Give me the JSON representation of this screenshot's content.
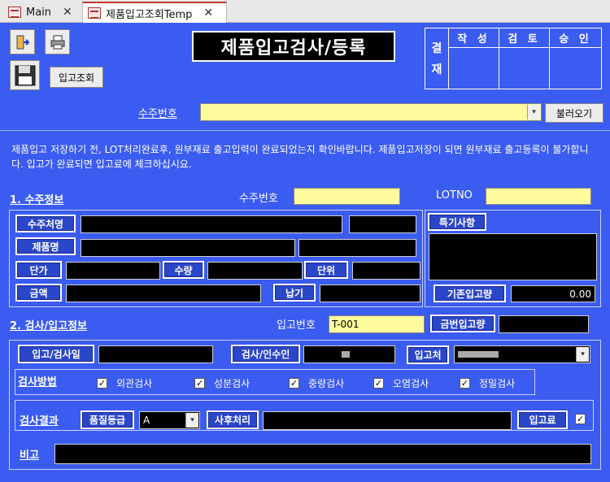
{
  "tabs": [
    {
      "label": "Main",
      "close": "✕"
    },
    {
      "label": "제품입고조회Temp",
      "close": "✕"
    }
  ],
  "toolbar": {
    "exit_icon": "exit-door-icon",
    "print_icon": "printer-icon",
    "save_icon": "floppy-disk-icon",
    "receipt_lookup_label": "입고조회"
  },
  "title": "제품입고검사/등록",
  "approval": {
    "label_top": "결",
    "label_bottom": "재",
    "columns": [
      "작 성",
      "검 토",
      "승 인"
    ]
  },
  "order_search": {
    "label": "수주번호",
    "value": "",
    "load_label": "불러오기"
  },
  "notice": "제품입고 저장하기 전, LOT처리완료후, 원부재료 출고입력이 완료되었는지 확인바랍니다. 제품입고저장이 되면 원부재료 출고등록이 불가합니다. 입고가 완료되면 입고료에 체크하십시요.",
  "section1": {
    "title": "1. 수주정보",
    "order_no_label": "수주번호",
    "order_no_value": "",
    "lotno_label": "LOTNO",
    "lotno_value": "",
    "customer_label": "수주처명",
    "product_label": "제품명",
    "price_label": "단가",
    "qty_label": "수량",
    "unit_label": "단위",
    "amount_label": "금액",
    "delivery_label": "납기",
    "special_label": "특기사항",
    "existing_qty_label": "기존입고량",
    "existing_qty_value": "0.00"
  },
  "section2": {
    "title": "2. 검사/입고정보",
    "receipt_no_label": "입고번호",
    "receipt_no_value": "T-001",
    "this_qty_label": "금번입고량",
    "this_qty_value": "",
    "date_label": "입고/검사일",
    "date_value": "",
    "inspector_label": "검사/인수인",
    "warehouse_label": "입고처",
    "method_label": "검사방법",
    "methods": [
      {
        "label": "외관검사",
        "checked": true
      },
      {
        "label": "성분검사",
        "checked": true
      },
      {
        "label": "중량검사",
        "checked": true
      },
      {
        "label": "오염검사",
        "checked": true
      },
      {
        "label": "정밀검사",
        "checked": true
      }
    ],
    "result_label": "검사결과",
    "grade_label": "품질등급",
    "grade_value": "A",
    "after_label": "사후처리",
    "after_value": "",
    "done_label": "입고료",
    "done_checked": true,
    "remark_label": "비고",
    "remark_value": ""
  },
  "check_mark": "✓",
  "dropdown_arrow": "▾"
}
